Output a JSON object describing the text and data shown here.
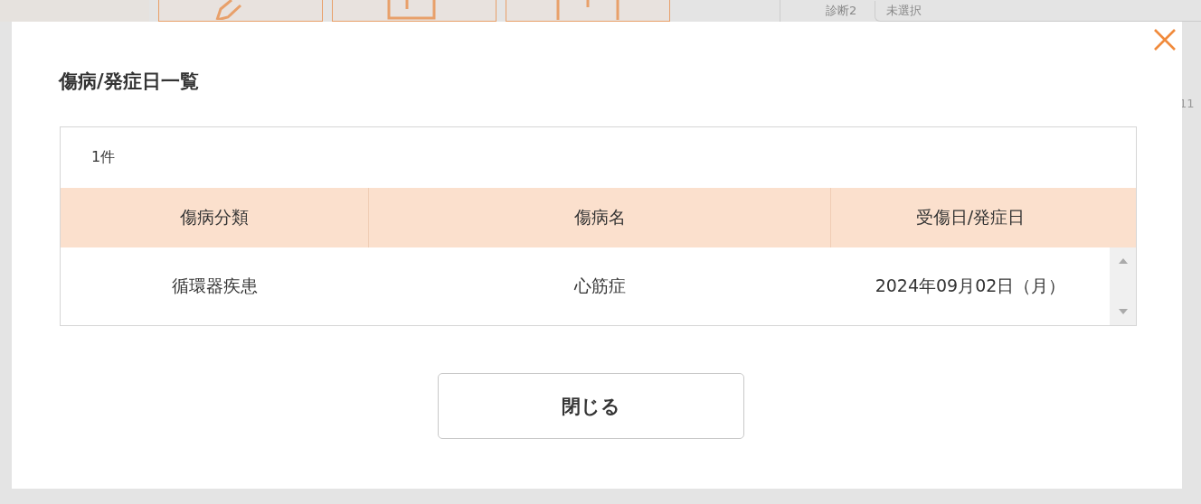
{
  "background": {
    "diagnosis_label": "診断2",
    "diagnosis_select": {
      "value": "未選択"
    },
    "side_value": "11"
  },
  "dialog": {
    "title": "傷病/発症日一覧",
    "count": "1件",
    "table": {
      "columns": [
        "傷病分類",
        "傷病名",
        "受傷日/発症日"
      ],
      "rows": [
        {
          "cells": [
            "循環器疾患",
            "心筋症",
            "2024年09月02日（月）"
          ]
        }
      ]
    },
    "close_button": "閉じる"
  }
}
